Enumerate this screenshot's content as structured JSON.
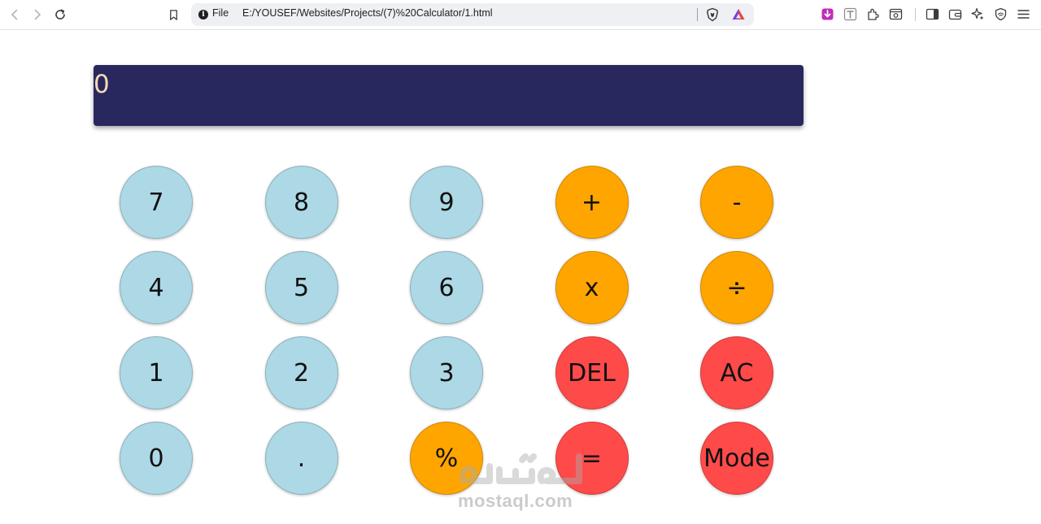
{
  "browser": {
    "scheme_label": "File",
    "url": "E:/YOUSEF/Websites/Projects/(7)%20Calculator/1.html",
    "icons": [
      "back-icon",
      "forward-icon",
      "reload-icon",
      "bookmark-icon",
      "info-icon",
      "brave-shield-icon",
      "rewards-icon",
      "download-extension-icon",
      "text-extension-icon",
      "extensions-icon",
      "screenshot-icon",
      "sidebar-icon",
      "wallet-icon",
      "leo-ai-icon",
      "vpn-icon",
      "menu-icon"
    ]
  },
  "calculator": {
    "display": "0",
    "keys": [
      {
        "label": "7",
        "kind": "num"
      },
      {
        "label": "8",
        "kind": "num"
      },
      {
        "label": "9",
        "kind": "num"
      },
      {
        "label": "+",
        "kind": "op"
      },
      {
        "label": "-",
        "kind": "op"
      },
      {
        "label": "4",
        "kind": "num"
      },
      {
        "label": "5",
        "kind": "num"
      },
      {
        "label": "6",
        "kind": "num"
      },
      {
        "label": "x",
        "kind": "op"
      },
      {
        "label": "÷",
        "kind": "op"
      },
      {
        "label": "1",
        "kind": "num"
      },
      {
        "label": "2",
        "kind": "num"
      },
      {
        "label": "3",
        "kind": "num"
      },
      {
        "label": "DEL",
        "kind": "fn"
      },
      {
        "label": "AC",
        "kind": "fn"
      },
      {
        "label": "0",
        "kind": "num"
      },
      {
        "label": ".",
        "kind": "num"
      },
      {
        "label": "%",
        "kind": "op"
      },
      {
        "label": "=",
        "kind": "fn"
      },
      {
        "label": "Mode",
        "kind": "fn"
      }
    ]
  },
  "colors": {
    "screen_bg": "#29285e",
    "screen_text": "#f3d9b8",
    "number_key": "#add8e6",
    "operator_key": "#ffa500",
    "function_key": "#ff4a4a"
  },
  "watermark": {
    "text": "mostaql.com"
  }
}
